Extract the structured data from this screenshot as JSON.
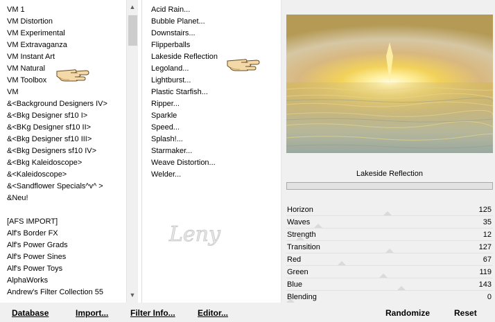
{
  "categories": [
    "VM 1",
    "VM Distortion",
    "VM Experimental",
    "VM Extravaganza",
    "VM Instant Art",
    "VM Natural",
    "VM Toolbox",
    "VM",
    "&<Background Designers IV>",
    "&<Bkg Designer sf10 I>",
    "&<BKg Designer sf10 II>",
    "&<Bkg Designer sf10 III>",
    "&<Bkg Designers sf10 IV>",
    "&<Bkg Kaleidoscope>",
    "&<Kaleidoscope>",
    "&<Sandflower Specials^v^ >",
    "&Neu!",
    "",
    "[AFS IMPORT]",
    "Alf's Border FX",
    "Alf's Power Grads",
    "Alf's Power Sines",
    "Alf's Power Toys",
    "AlphaWorks",
    "Andrew's Filter Collection 55"
  ],
  "selected_category": "VM Natural",
  "filters": [
    "Acid Rain...",
    "Bubble Planet...",
    "Downstairs...",
    "Flipperballs",
    "Lakeside Reflection",
    "Legoland...",
    "Lightburst...",
    "Plastic Starfish...",
    "Ripper...",
    "Sparkle",
    "Speed...",
    "Splash!...",
    "Starmaker...",
    "Weave Distortion...",
    "Welder..."
  ],
  "selected_filter": "Lakeside Reflection",
  "watermark": "Leny",
  "preview": {
    "filter_name": "Lakeside Reflection"
  },
  "params": [
    {
      "name": "Horizon",
      "value": "125",
      "level": 0.49
    },
    {
      "name": "Waves",
      "value": "35",
      "level": 0.14
    },
    {
      "name": "Strength",
      "value": "12",
      "level": 0.05
    },
    {
      "name": "Transition",
      "value": "127",
      "level": 0.5
    },
    {
      "name": "Red",
      "value": "67",
      "level": 0.26
    },
    {
      "name": "Green",
      "value": "119",
      "level": 0.47
    },
    {
      "name": "Blue",
      "value": "143",
      "level": 0.56
    },
    {
      "name": "Blending",
      "value": "0",
      "level": 0.0
    }
  ],
  "toolbar": {
    "database": "Database",
    "import": "Import...",
    "filter_info": "Filter Info...",
    "editor": "Editor...",
    "randomize": "Randomize",
    "reset": "Reset"
  },
  "icons": {
    "scroll_up": "chevron-up-icon",
    "scroll_down": "chevron-down-icon",
    "pointer": "pointing-hand-icon"
  },
  "colors": {
    "panel_bg": "#f0f0f0",
    "list_bg": "#ffffff",
    "sky_gold": "#e8c860",
    "sun_center": "#fff6c8"
  }
}
